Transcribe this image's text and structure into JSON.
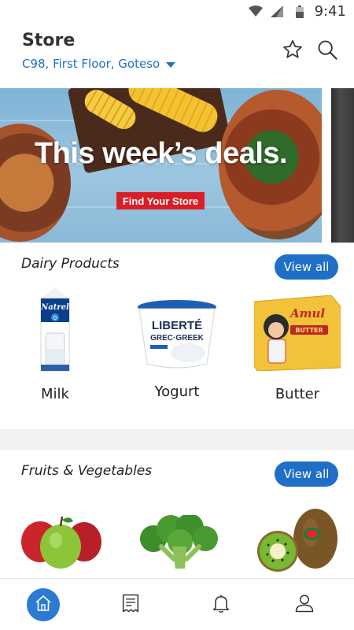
{
  "status_bar": {
    "time": "9:41"
  },
  "header": {
    "title": "Store",
    "location": "C98, First Floor, Goteso"
  },
  "banner": {
    "headline": "This week’s deals.",
    "button_label": "Find Your Store"
  },
  "sections": [
    {
      "title": "Dairy Products",
      "view_all_label": "View all",
      "items": [
        {
          "label": "Milk",
          "image": "milk-carton",
          "image_text": "Natrel"
        },
        {
          "label": "Yogurt",
          "image": "yogurt-tub",
          "image_text": "LIBERTÉ"
        },
        {
          "label": "Butter",
          "image": "butter-pack",
          "image_text": "Amul"
        }
      ]
    },
    {
      "title": "Fruits & Vegetables",
      "view_all_label": "View all",
      "items": [
        {
          "image": "apples"
        },
        {
          "image": "broccoli"
        },
        {
          "image": "kiwi"
        }
      ]
    }
  ],
  "bottom_nav": [
    {
      "icon": "home-icon",
      "active": true
    },
    {
      "icon": "receipt-icon",
      "active": false
    },
    {
      "icon": "bell-icon",
      "active": false
    },
    {
      "icon": "profile-icon",
      "active": false
    }
  ],
  "colors": {
    "accent": "#1f6fc6",
    "nav_active": "#2b7ad3",
    "banner_button": "#d81f26",
    "section_band": "#f1f2f4"
  }
}
